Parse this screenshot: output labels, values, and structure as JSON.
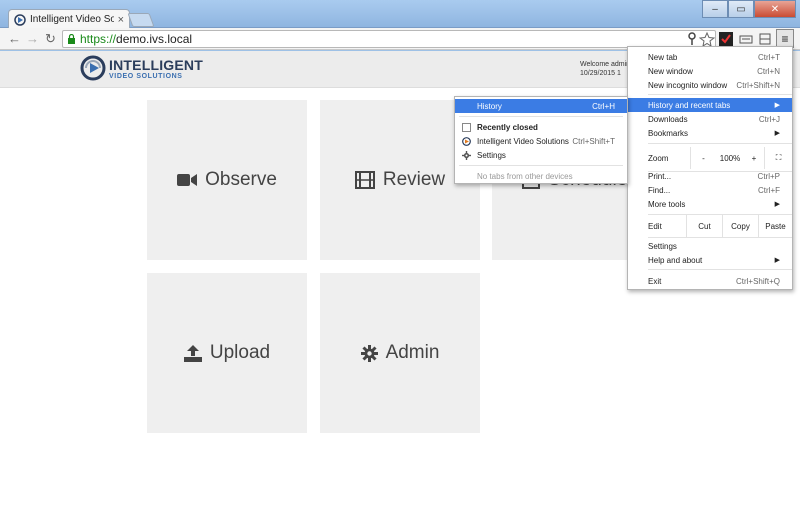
{
  "browser": {
    "tab_title": "Intelligent Video Solutions",
    "tab_close": "×",
    "url_scheme": "https://",
    "url_host": "demo.ivs.local",
    "back": "←",
    "forward": "→",
    "reload": "↻",
    "window_minimize": "–",
    "window_maximize": "▭",
    "window_close": "✕",
    "menu_icon": "≡"
  },
  "app": {
    "logo_line1": "INTELLIGENT",
    "logo_line2": "VIDEO SOLUTIONS",
    "welcome_line1": "Welcome admin",
    "welcome_line2": "10/29/2015 1",
    "tiles": [
      {
        "label": "Observe",
        "icon": "video-camera-icon"
      },
      {
        "label": "Review",
        "icon": "film-icon"
      },
      {
        "label": "Schedule",
        "icon": "calendar-icon"
      },
      {
        "label": "Upload",
        "icon": "upload-icon"
      },
      {
        "label": "Admin",
        "icon": "gear-icon"
      }
    ]
  },
  "chrome_menu": {
    "new_tab": {
      "label": "New tab",
      "shortcut": "Ctrl+T"
    },
    "new_window": {
      "label": "New window",
      "shortcut": "Ctrl+N"
    },
    "new_incognito": {
      "label": "New incognito window",
      "shortcut": "Ctrl+Shift+N"
    },
    "history_recent": {
      "label": "History and recent tabs"
    },
    "downloads": {
      "label": "Downloads",
      "shortcut": "Ctrl+J"
    },
    "bookmarks": {
      "label": "Bookmarks"
    },
    "zoom": {
      "label": "Zoom",
      "minus": "-",
      "value": "100%",
      "plus": "+",
      "fullscreen": "⛶"
    },
    "print": {
      "label": "Print...",
      "shortcut": "Ctrl+P"
    },
    "find": {
      "label": "Find...",
      "shortcut": "Ctrl+F"
    },
    "more_tools": {
      "label": "More tools"
    },
    "edit": {
      "label": "Edit",
      "cut": "Cut",
      "copy": "Copy",
      "paste": "Paste"
    },
    "settings": {
      "label": "Settings"
    },
    "help": {
      "label": "Help and about"
    },
    "exit": {
      "label": "Exit",
      "shortcut": "Ctrl+Shift+Q"
    }
  },
  "history_submenu": {
    "history": {
      "label": "History",
      "shortcut": "Ctrl+H"
    },
    "recently_closed": "Recently closed",
    "closed_item": {
      "label": "Intelligent Video Solutions",
      "shortcut": "Ctrl+Shift+T"
    },
    "settings": "Settings",
    "no_tabs": "No tabs from other devices"
  },
  "colors": {
    "highlight": "#3b7ce4",
    "tile_bg": "#efefef",
    "url_green": "#1a8a1a"
  }
}
